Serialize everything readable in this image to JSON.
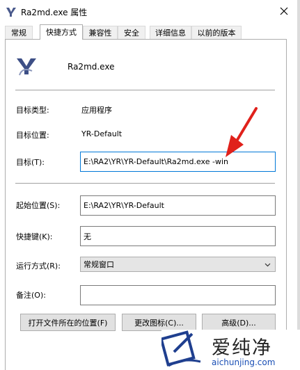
{
  "window": {
    "title": "Ra2md.exe 属性"
  },
  "tabs": [
    {
      "label": "常规"
    },
    {
      "label": "快捷方式"
    },
    {
      "label": "兼容性"
    },
    {
      "label": "安全"
    },
    {
      "label": "详细信息"
    },
    {
      "label": "以前的版本"
    }
  ],
  "shortcut": {
    "name": "Ra2md.exe",
    "target_type_label": "目标类型:",
    "target_type_value": "应用程序",
    "target_location_label": "目标位置:",
    "target_location_value": "YR-Default",
    "target_label": "目标(T):",
    "target_value": "E:\\RA2\\YR\\YR-Default\\Ra2md.exe -win",
    "start_in_label": "起始位置(S):",
    "start_in_value": "E:\\RA2\\YR\\YR-Default",
    "hotkey_label": "快捷键(K):",
    "hotkey_value": "无",
    "run_label": "运行方式(R):",
    "run_value": "常规窗口",
    "comment_label": "备注(O):",
    "comment_value": ""
  },
  "buttons": {
    "open_location": "打开文件所在的位置(F)",
    "change_icon": "更改图标(C)...",
    "advanced": "高级(D)..."
  },
  "watermark": {
    "brand": "爱纯净",
    "url": "aichunjing.com"
  },
  "colors": {
    "accent": "#0078d7",
    "arrow": "#e0211b",
    "watermark_url": "#1a4fb5"
  }
}
